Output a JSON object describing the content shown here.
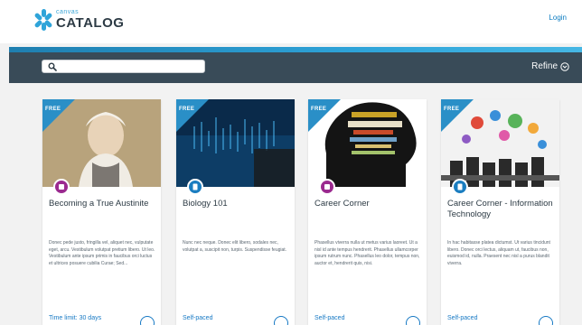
{
  "header": {
    "logo_small": "canvas",
    "logo_big": "CATALOG",
    "login_label": "Login"
  },
  "search": {
    "placeholder": "",
    "value": "",
    "refine_label": "Refine"
  },
  "colors": {
    "accent_blue": "#2a8fc7",
    "nav_dark": "#394b58",
    "link_blue": "#1779c4",
    "badge_purple": "#9b2a8f",
    "badge_blue": "#1a7dc0"
  },
  "courses": [
    {
      "badge": "FREE",
      "icon": "course-type-icon",
      "icon_color": "#9b2a8f",
      "title": "Becoming a True Austinite",
      "description": "Donec pede justo, fringilla vel, aliquet nec, vulputate eget, arcu. Vestibulum volutpat pretium libero. Ut leo. Vestibulum ante ipsum primis in faucibus orci luctus et ultrices posuere cubilia Curae; Sed...",
      "footer": "Time limit: 30 days"
    },
    {
      "badge": "FREE",
      "icon": "course-type-icon",
      "icon_color": "#1a7dc0",
      "title": "Biology 101",
      "description": "Nunc nec neque. Donec elit libero, sodales nec, volutpat a, suscipit non, turpis. Suspendisse feugiat.",
      "footer": "Self-paced"
    },
    {
      "badge": "FREE",
      "icon": "course-type-icon",
      "icon_color": "#9b2a8f",
      "title": "Career Corner",
      "description": "Phasellus viverra nulla ut metus varius laoreet. Ut a nisl id ante tempus hendrerit. Phasellus ullamcorper ipsum rutrum nunc. Phasellus leo dolor, tempus non, auctor et, hendrerit quis, nisi.",
      "footer": "Self-paced"
    },
    {
      "badge": "FREE",
      "icon": "course-type-icon",
      "icon_color": "#1a7dc0",
      "title": "Career Corner - Information Technology",
      "description": "In hac habitasse platea dictumst. Ut varius tincidunt libero. Donec orci lectus, aliquam ut, faucibus non, euismod id, nulla. Praesent nec nisl a purus blandit viverra.",
      "footer": "Self-paced"
    }
  ]
}
